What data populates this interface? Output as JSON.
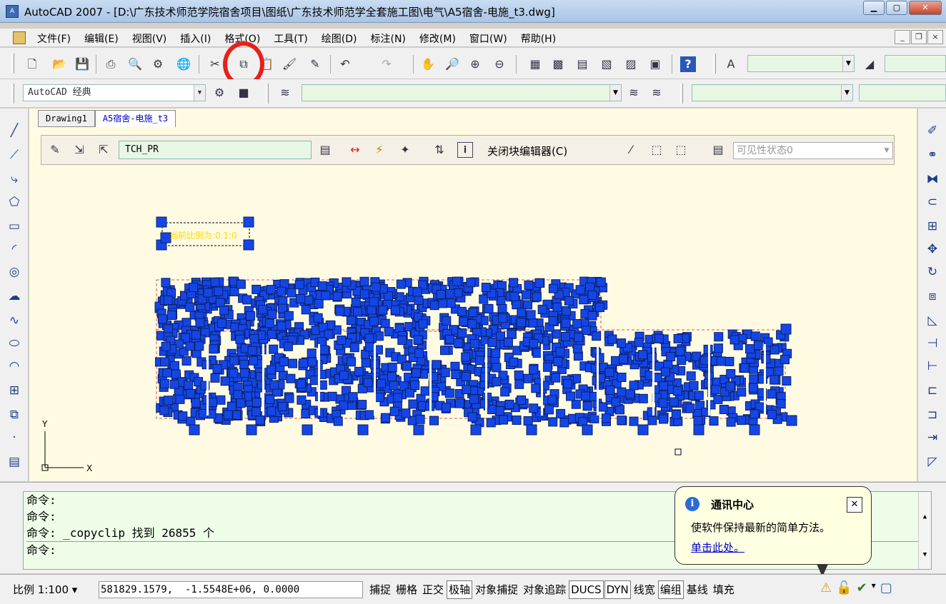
{
  "titlebar": {
    "title": "AutoCAD 2007 - [D:\\广东技术师范学院宿舍项目\\图纸\\广东技术师范学全套施工图\\电气\\A5宿舍-电施_t3.dwg]",
    "min": "▁",
    "max": "▢",
    "close": "✕"
  },
  "menu": {
    "items": [
      "文件(F)",
      "编辑(E)",
      "视图(V)",
      "插入(I)",
      "格式(O)",
      "工具(T)",
      "绘图(D)",
      "标注(N)",
      "修改(M)",
      "窗口(W)",
      "帮助(H)"
    ],
    "mdi_min": "_",
    "mdi_restore": "❐",
    "mdi_close": "×"
  },
  "toolbar2": {
    "workspace": "AutoCAD 经典"
  },
  "tabs": [
    "Drawing1",
    "A5宿舍-电施_t3"
  ],
  "block_editor": {
    "block_name": "TCH_PR",
    "close_label": "关闭块编辑器(C)",
    "visibility": "可见性状态0"
  },
  "drawing": {
    "label_text": "当前比例为:0.1:0",
    "axis_y": "Y",
    "axis_x": "X"
  },
  "command": {
    "lines": [
      "命令:",
      "命令:",
      "命令: _copyclip 找到 26855 个"
    ],
    "prompt": "命令:"
  },
  "balloon": {
    "title": "通讯中心",
    "text": "使软件保持最新的简单方法。",
    "link": "单击此处。"
  },
  "status": {
    "scale": "比例 1:100 ▾",
    "coords": "581829.1579,  -1.5548E+06, 0.0000",
    "buttons": [
      {
        "label": "捕捉",
        "on": false
      },
      {
        "label": "栅格",
        "on": false
      },
      {
        "label": "正交",
        "on": false
      },
      {
        "label": "极轴",
        "on": true
      },
      {
        "label": "对象捕捉",
        "on": false
      },
      {
        "label": "对象追踪",
        "on": false
      },
      {
        "label": "DUCS",
        "on": true
      },
      {
        "label": "DYN",
        "on": true
      },
      {
        "label": "线宽",
        "on": false
      },
      {
        "label": "编组",
        "on": true
      },
      {
        "label": "基线",
        "on": false
      },
      {
        "label": "填充",
        "on": false
      }
    ]
  },
  "colors": {
    "canvas_bg": "#fffbe3",
    "grip": "#1446e6",
    "highlight_circle": "#e8201a"
  }
}
